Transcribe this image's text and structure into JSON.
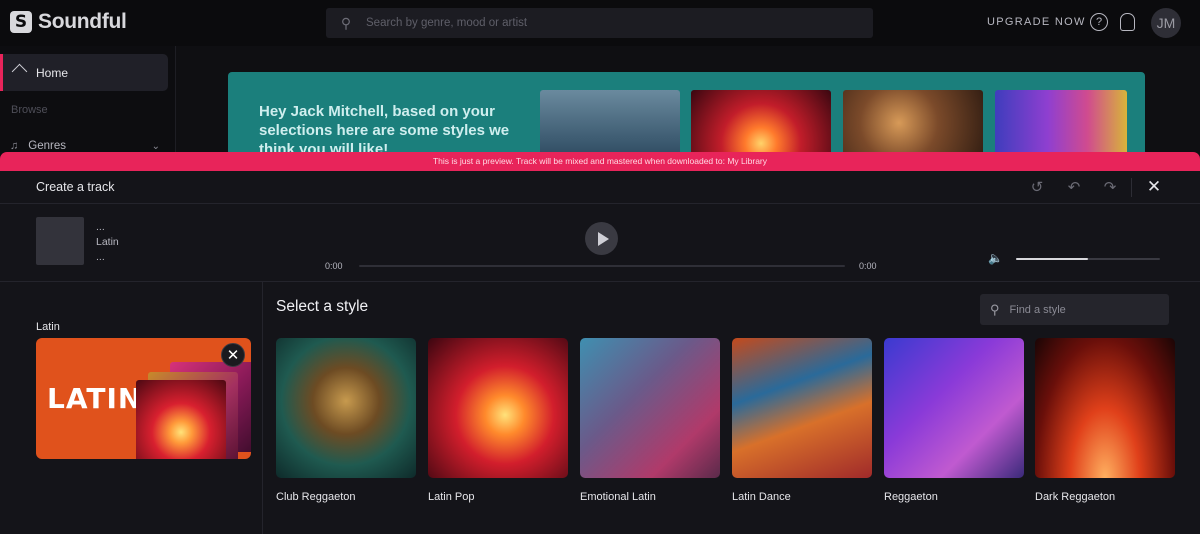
{
  "topbar": {
    "brand": "Soundful",
    "brand_mark": "S",
    "search_placeholder": "Search by genre, mood or artist",
    "upgrade": "UPGRADE NOW",
    "avatar_initials": "JM"
  },
  "sidebar": {
    "home": "Home",
    "browse": "Browse",
    "genres": "Genres"
  },
  "hero": {
    "text": "Hey Jack Mitchell, based on your selections here are some styles we think you will like!"
  },
  "banner": {
    "text": "This is just a preview. Track will be mixed and mastered when downloaded to: My Library"
  },
  "panel": {
    "title": "Create a track",
    "track": {
      "line1": "...",
      "genre": "Latin",
      "line3": "..."
    },
    "time_start": "0:00",
    "time_end": "0:00",
    "volume": 0.5
  },
  "selected_style": {
    "logo_text": "LATIN",
    "label": "Latin"
  },
  "styles": {
    "heading": "Select a style",
    "search_placeholder": "Find a style",
    "items": [
      {
        "label": "Club Reggaeton"
      },
      {
        "label": "Latin Pop"
      },
      {
        "label": "Emotional Latin"
      },
      {
        "label": "Latin Dance"
      },
      {
        "label": "Reggaeton"
      },
      {
        "label": "Dark Reggaeton"
      }
    ]
  },
  "colors": {
    "accent": "#e8245a",
    "hero": "#1b7f7c",
    "latin_card": "#e0521c"
  }
}
